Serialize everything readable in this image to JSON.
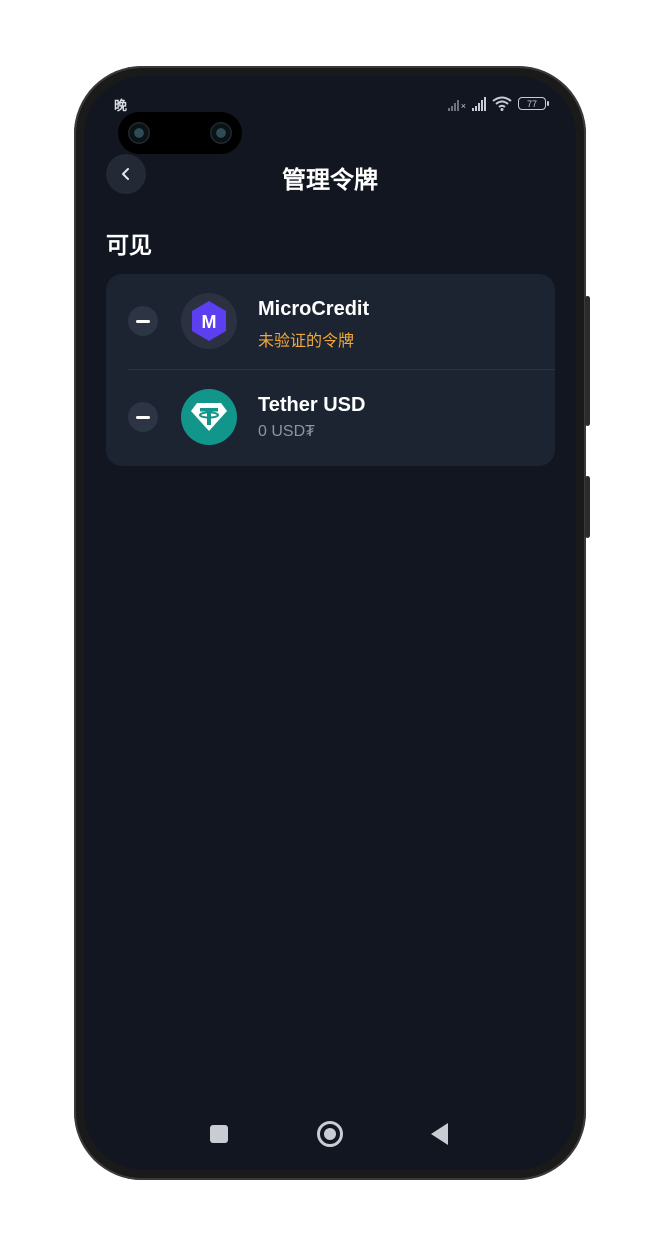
{
  "status_bar": {
    "time": "晚",
    "battery": "77"
  },
  "header": {
    "title": "管理令牌",
    "back_icon": "chevron-left-icon"
  },
  "section": {
    "label": "可见"
  },
  "tokens": [
    {
      "name": "MicroCredit",
      "subtitle": "未验证的令牌",
      "icon": "microcredit-logo-icon",
      "subtitle_color": "#f2a93b"
    },
    {
      "name": "Tether USD",
      "subtitle": "0 USD₮",
      "icon": "tether-logo-icon",
      "subtitle_color": "#8d94a2"
    }
  ],
  "colors": {
    "background": "#111620",
    "card": "#1c2331",
    "warning": "#f2a93b",
    "tether": "#12958b",
    "microcredit": "#5b3ff0"
  },
  "navigation": {
    "recent_icon": "square-icon",
    "home_icon": "circle-home-icon",
    "back_icon": "triangle-back-icon"
  }
}
